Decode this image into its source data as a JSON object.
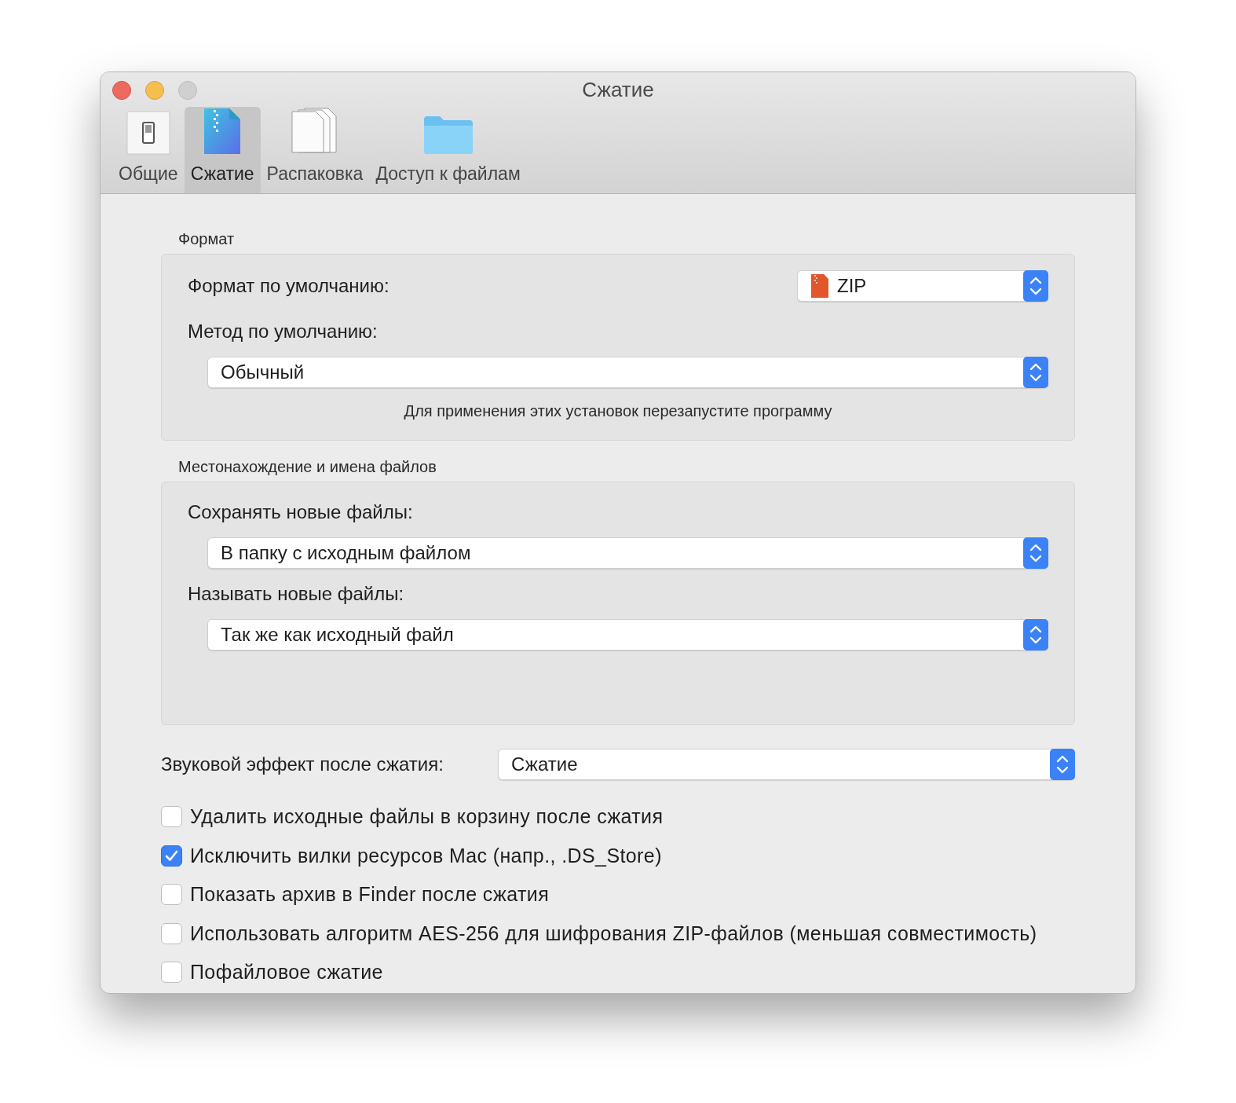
{
  "window": {
    "title": "Сжатие"
  },
  "tabs": [
    {
      "label": "Общие",
      "selected": false
    },
    {
      "label": "Сжатие",
      "selected": true
    },
    {
      "label": "Распаковка",
      "selected": false
    },
    {
      "label": "Доступ к файлам",
      "selected": false
    }
  ],
  "sections": [
    {
      "title": "Формат",
      "fields": [
        {
          "kind": "inline",
          "label": "Формат по умолчанию:",
          "value": "ZIP"
        },
        {
          "kind": "stacked",
          "label": "Метод по умолчанию:",
          "value": "Обычный"
        }
      ],
      "note": "Для применения этих установок перезапустите программу"
    },
    {
      "title": "Местонахождение и имена файлов",
      "fields": [
        {
          "kind": "stacked",
          "label": "Сохранять новые файлы:",
          "value": "В папку с исходным файлом"
        },
        {
          "kind": "stacked",
          "label": "Называть новые файлы:",
          "value": "Так же как исходный файл"
        }
      ]
    }
  ],
  "sound": {
    "label": "Звуковой эффект после сжатия:",
    "value": "Сжатие"
  },
  "options": [
    {
      "label": "Удалить исходные файлы в корзину после сжатия",
      "checked": false
    },
    {
      "label": "Исключить вилки ресурсов Mac (напр., .DS_Store)",
      "checked": true
    },
    {
      "label": "Показать архив в Finder после сжатия",
      "checked": false
    },
    {
      "label": "Использовать алгоритм AES-256 для шифрования ZIP-файлов (меньшая совместимость)",
      "checked": false
    },
    {
      "label": "Пофайловое сжатие",
      "checked": false
    }
  ]
}
